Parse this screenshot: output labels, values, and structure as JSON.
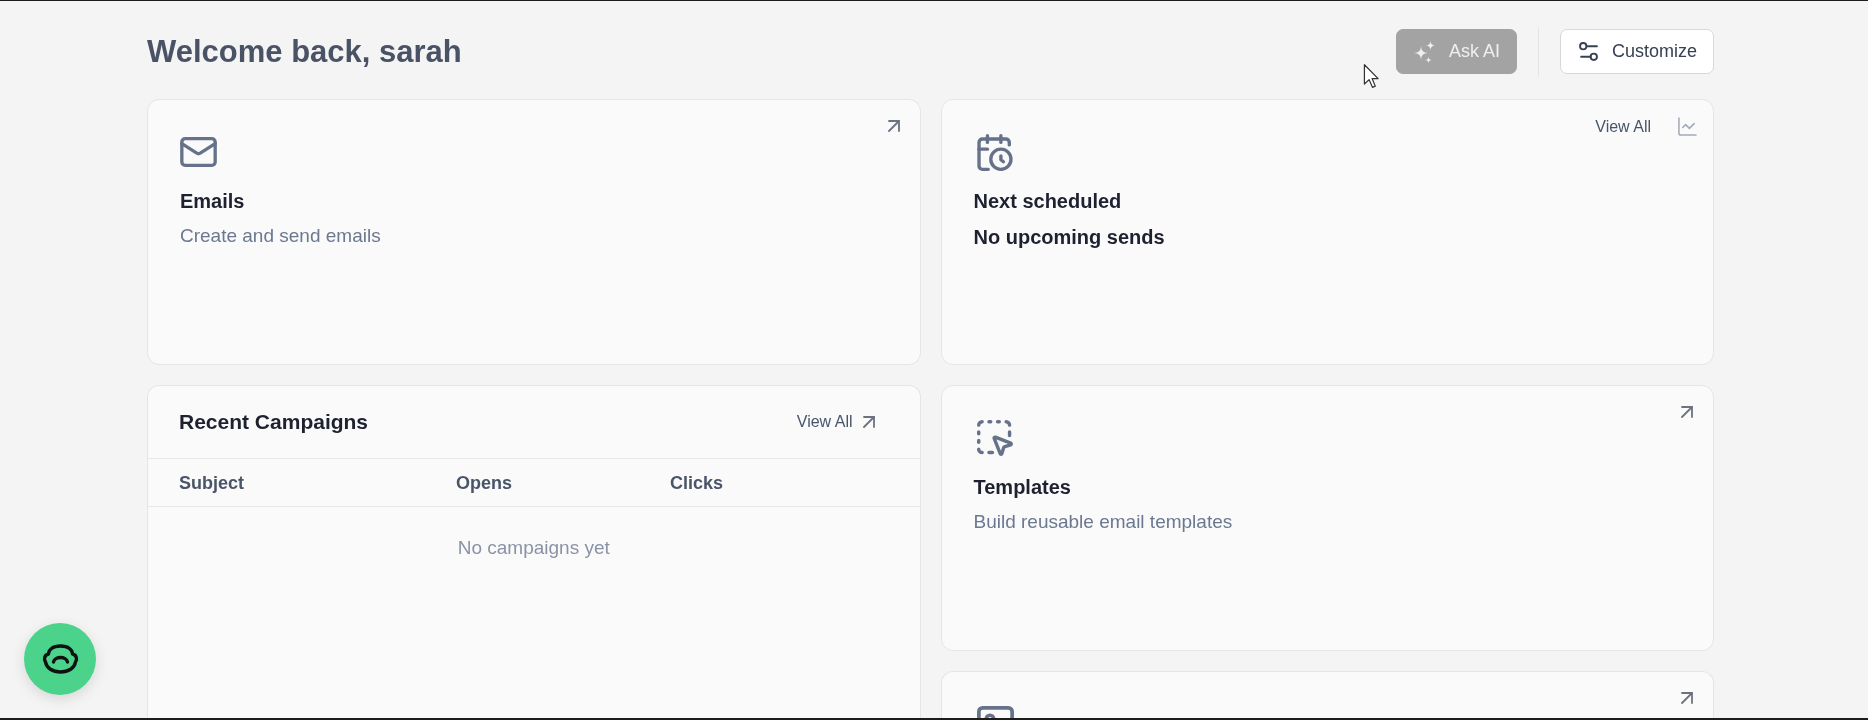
{
  "header": {
    "title": "Welcome back, sarah",
    "buttons": [
      {
        "kind": "primary",
        "label": "Ask AI",
        "disabled": true
      },
      {
        "kind": "outline",
        "label": "Customize",
        "disabled": false
      }
    ]
  },
  "columns": [
    {
      "widgets": [
        {
          "kind": "feature",
          "title": "Emails",
          "description": "Create and send emails"
        },
        {
          "kind": "table",
          "title": "Recent Campaigns",
          "link": "View All",
          "columns": [
            "Subject",
            "Opens",
            "Clicks"
          ],
          "empty_message": "No campaigns yet"
        }
      ]
    },
    {
      "widgets": [
        {
          "kind": "status",
          "link": "View All",
          "title": "Next scheduled",
          "value": "No upcoming sends"
        },
        {
          "kind": "feature",
          "title": "Templates",
          "description": "Build reusable email templates"
        },
        {
          "kind": "feature"
        }
      ]
    }
  ]
}
